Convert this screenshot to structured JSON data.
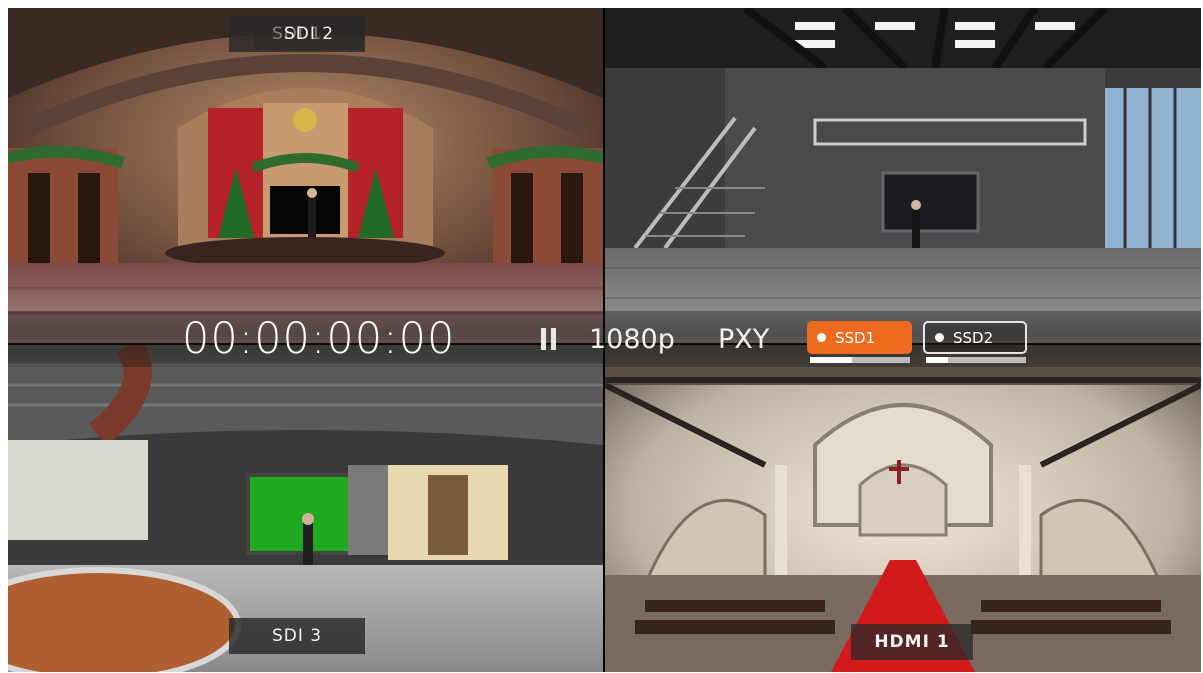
{
  "sources": [
    {
      "label": "SDI 1",
      "scene": "christmas-stage"
    },
    {
      "label": "SDI  2",
      "scene": "industrial-loft"
    },
    {
      "label": "SDI  3",
      "scene": "green-screen-studio"
    },
    {
      "label": "HDMI 1",
      "scene": "cathedral"
    }
  ],
  "status": {
    "timecode": "00:00:00:00",
    "transport_state": "paused",
    "resolution": "1080p",
    "proxy": "PXY",
    "storage": [
      {
        "label": "SSD1",
        "active": true,
        "level": 0.42
      },
      {
        "label": "SSD2",
        "active": false,
        "level": 0.22
      }
    ]
  },
  "colors": {
    "accent_active": "#ee6a1e",
    "text": "#ffffff"
  }
}
